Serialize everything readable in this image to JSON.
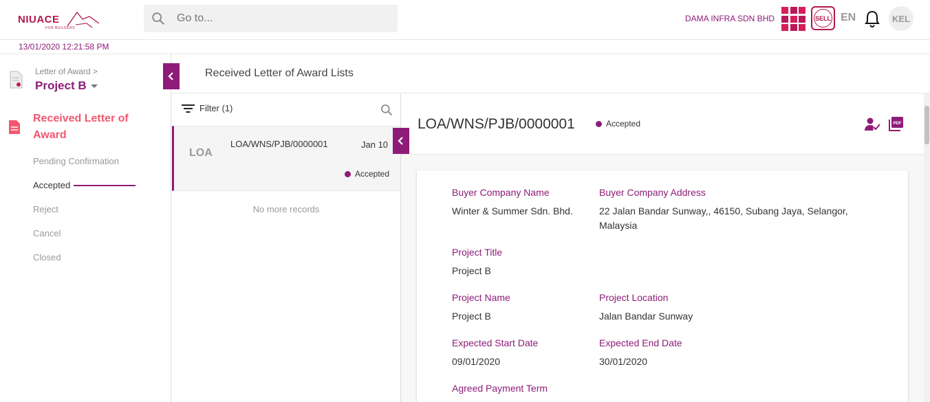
{
  "app": {
    "logo_text": "NIUACE",
    "logo_sub": "FOR BUILDERS",
    "company": "DAMA INFRA SDN BHD",
    "sell_label": "SELL",
    "language": "EN",
    "user_initials": "KEL",
    "datetime": "13/01/2020 12:21:58 PM"
  },
  "search": {
    "placeholder": "Go to..."
  },
  "sidebar": {
    "breadcrumb": "Letter of Award >",
    "project": "Project B",
    "section_title": "Received Letter of Award",
    "items": [
      {
        "label": "Pending Confirmation"
      },
      {
        "label": "Accepted"
      },
      {
        "label": "Reject"
      },
      {
        "label": "Cancel"
      },
      {
        "label": "Closed"
      }
    ]
  },
  "main": {
    "title": "Received Letter of Award Lists"
  },
  "list": {
    "filter_label": "Filter (1)",
    "items": [
      {
        "badge": "LOA",
        "ref": "LOA/WNS/PJB/0000001",
        "date": "Jan 10",
        "status": "Accepted"
      }
    ],
    "end_text": "No more records"
  },
  "detail": {
    "ref": "LOA/WNS/PJB/0000001",
    "status": "Accepted",
    "fields": {
      "buyer_company_name_label": "Buyer Company Name",
      "buyer_company_name": "Winter & Summer Sdn. Bhd.",
      "buyer_company_address_label": "Buyer Company Address",
      "buyer_company_address": "22 Jalan Bandar Sunway,, 46150, Subang Jaya, Selangor, Malaysia",
      "project_title_label": "Project Title",
      "project_title": "Project B",
      "project_name_label": "Project Name",
      "project_name": "Project B",
      "project_location_label": "Project Location",
      "project_location": "Jalan Bandar Sunway",
      "expected_start_label": "Expected Start Date",
      "expected_start": "09/01/2020",
      "expected_end_label": "Expected End Date",
      "expected_end": "30/01/2020",
      "payment_term_label": "Agreed Payment Term"
    }
  },
  "colors": {
    "brand": "#8e1b78",
    "accent": "#f0586e",
    "logo": "#b0174f"
  },
  "icons": [
    "search-icon",
    "apps-grid-icon",
    "bell-icon",
    "document-icon",
    "filter-icon",
    "chevron-left-icon",
    "user-check-icon",
    "pdf-icon"
  ]
}
